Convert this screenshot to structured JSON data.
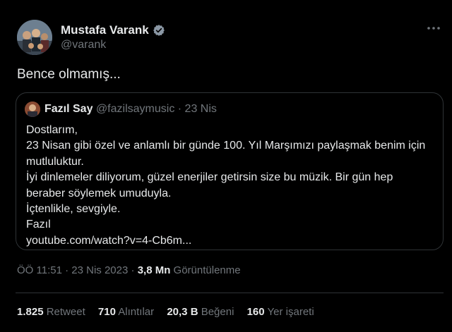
{
  "author": {
    "name": "Mustafa Varank",
    "handle": "@varank"
  },
  "tweet_text": "Bence olmamış...",
  "quote": {
    "name": "Fazıl Say",
    "handle": "@fazilsaymusic",
    "separator": "·",
    "date": "23 Nis",
    "lines": [
      "Dostlarım,",
      "23 Nisan gibi özel ve anlamlı bir günde 100. Yıl Marşımızı paylaşmak benim için",
      "mutluluktur.",
      "İyi dinlemeler diliyorum, güzel enerjiler getirsin size bu müzik. Bir gün hep",
      "beraber söylemek umuduyla.",
      "İçtenlikle, sevgiyle.",
      "Fazıl"
    ],
    "link": "youtube.com/watch?v=4-Cb6m..."
  },
  "meta": {
    "time": "ÖÖ 11:51",
    "separator": "·",
    "date": "23 Nis 2023",
    "views_count": "3,8 Mn",
    "views_label": "Görüntülenme"
  },
  "stats": {
    "retweets": {
      "count": "1.825",
      "label": "Retweet"
    },
    "quotes": {
      "count": "710",
      "label": "Alıntılar"
    },
    "likes": {
      "count": "20,3 B",
      "label": "Beğeni"
    },
    "bookmarks": {
      "count": "160",
      "label": "Yer işareti"
    }
  },
  "colors": {
    "background": "#000000",
    "text": "#e7e9ea",
    "muted": "#71767b",
    "verified": "#8b98a5",
    "border": "#2f3336"
  },
  "icons": [
    "verified-badge-icon",
    "more-options-icon"
  ]
}
